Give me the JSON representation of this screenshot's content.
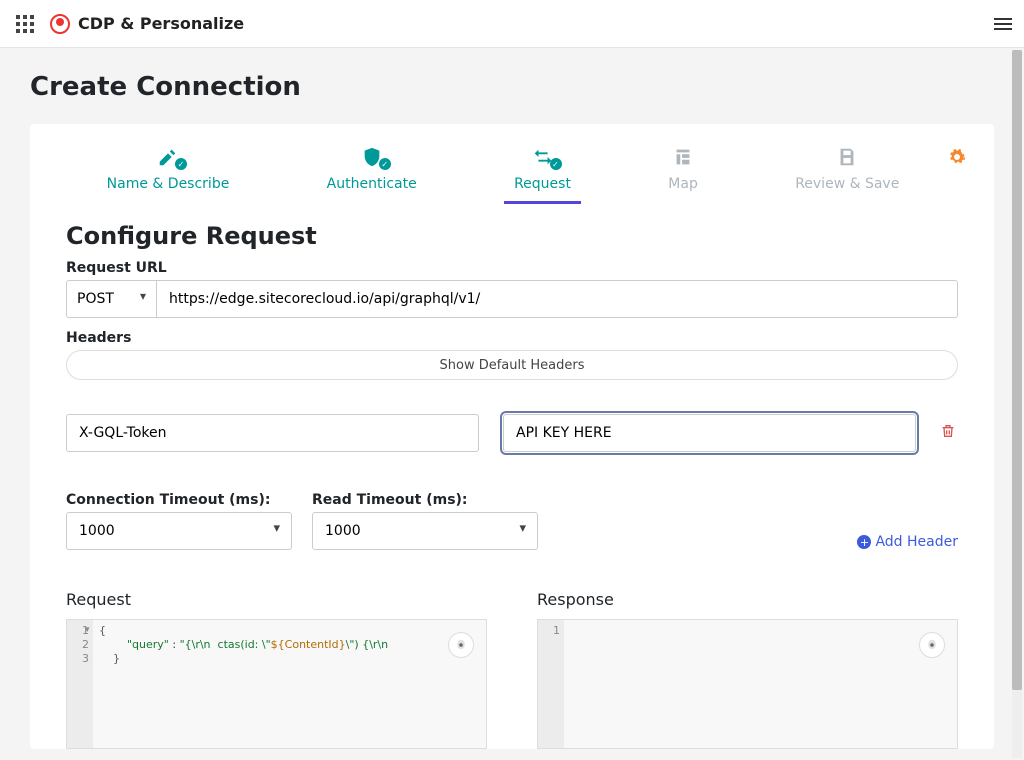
{
  "topbar": {
    "product": "CDP & Personalize"
  },
  "page": {
    "title": "Create Connection"
  },
  "steps": {
    "items": [
      {
        "label": "Name & Describe",
        "state": "done"
      },
      {
        "label": "Authenticate",
        "state": "done"
      },
      {
        "label": "Request",
        "state": "active"
      },
      {
        "label": "Map",
        "state": "disabled"
      },
      {
        "label": "Review & Save",
        "state": "disabled"
      }
    ]
  },
  "request": {
    "section_title": "Configure Request",
    "url_label": "Request URL",
    "method_value": "POST",
    "url_value": "https://edge.sitecorecloud.io/api/graphql/v1/",
    "headers_label": "Headers",
    "show_default_headers": "Show Default Headers",
    "header_rows": [
      {
        "key": "X-GQL-Token",
        "value": "API KEY HERE"
      }
    ],
    "connection_timeout_label": "Connection Timeout (ms):",
    "read_timeout_label": "Read Timeout (ms):",
    "connection_timeout_value": "1000",
    "read_timeout_value": "1000",
    "add_header_label": "Add Header"
  },
  "editors": {
    "request_title": "Request",
    "response_title": "Response",
    "request_lines": [
      "1",
      "2",
      "3"
    ],
    "request_code_l1": "{",
    "request_code_l2a": "\"query\"",
    "request_code_l2b": " : ",
    "request_code_l2c": "\"{\\r\\n  ctas(id: \\\"",
    "request_code_l2d": "${ContentId}",
    "request_code_l2e": "\\\") {\\r\\n",
    "request_code_l3": "}",
    "response_lines": [
      "1"
    ]
  }
}
